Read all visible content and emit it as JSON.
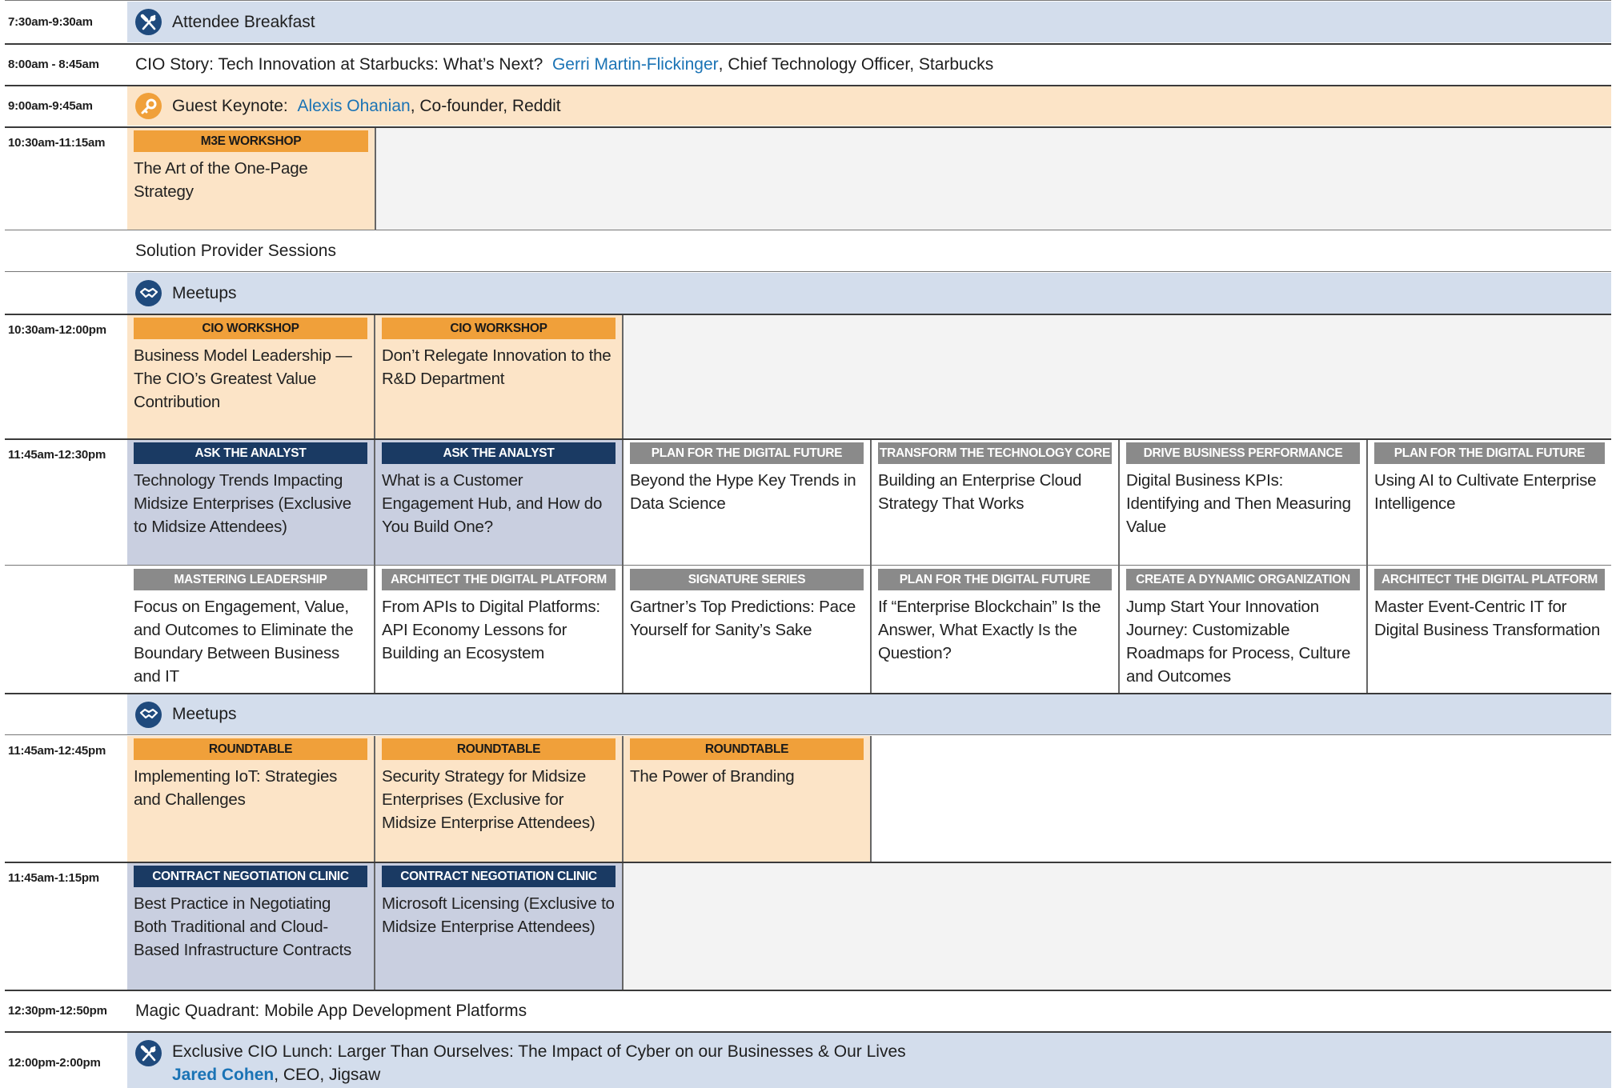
{
  "rows": {
    "breakfast": {
      "time": "7:30am-9:30am",
      "title": "Attendee Breakfast"
    },
    "cio_story": {
      "time": "8:00am - 8:45am",
      "title": "CIO Story: Tech Innovation at Starbucks: What’s Next?",
      "speaker": "Gerri Martin-Flickinger",
      "role": ", Chief Technology Officer, Starbucks"
    },
    "keynote": {
      "time": "9:00am-9:45am",
      "prefix": "Guest Keynote:",
      "speaker": "Alexis Ohanian",
      "role": ", Co-founder, Reddit"
    },
    "workshop_m3e": {
      "time": "10:30am-11:15am",
      "label": "M3E WORKSHOP",
      "title": "The Art of the One-Page Strategy"
    },
    "solution_provider": {
      "title": "Solution Provider Sessions"
    },
    "meetups_1": {
      "title": "Meetups"
    },
    "cio_workshops": {
      "time": "10:30am-12:00pm",
      "items": [
        {
          "label": "CIO WORKSHOP",
          "title": "Business Model Leadership — The CIO’s Greatest Value Contribution"
        },
        {
          "label": "CIO WORKSHOP",
          "title": "Don’t Relegate Innovation to the R&D Department"
        }
      ]
    },
    "sessions_1145": {
      "time": "11:45am-12:30pm",
      "row1": [
        {
          "label": "ASK THE ANALYST",
          "title": "Technology Trends Impacting Midsize Enterprises (Exclusive to Midsize Attendees)"
        },
        {
          "label": "ASK THE ANALYST",
          "title": "What is a Customer Engagement Hub, and How do You Build One?"
        },
        {
          "label": "PLAN FOR THE DIGITAL FUTURE",
          "title": "Beyond the Hype Key Trends in Data Science"
        },
        {
          "label": "TRANSFORM THE TECHNOLOGY CORE",
          "title": "Building an Enterprise Cloud Strategy That Works"
        },
        {
          "label": "DRIVE BUSINESS PERFORMANCE",
          "title": "Digital Business KPIs: Identifying and Then Measuring Value"
        },
        {
          "label": "PLAN FOR THE DIGITAL FUTURE",
          "title": "Using AI to Cultivate Enterprise Intelligence"
        }
      ],
      "row2": [
        {
          "label": "MASTERING LEADERSHIP",
          "title": "Focus on Engagement, Value, and Outcomes to Eliminate the Boundary Between Business and IT"
        },
        {
          "label": "ARCHITECT THE DIGITAL PLATFORM",
          "title": "From APIs to Digital Platforms: API Economy Lessons for Building an Ecosystem"
        },
        {
          "label": "SIGNATURE SERIES",
          "title": "Gartner’s Top Predictions: Pace Yourself for Sanity’s Sake"
        },
        {
          "label": "PLAN FOR THE DIGITAL FUTURE",
          "title": "If “Enterprise Blockchain” Is the Answer, What Exactly Is the Question?"
        },
        {
          "label": "CREATE A DYNAMIC ORGANIZATION",
          "title": "Jump Start Your Innovation Journey: Customizable Roadmaps for Process, Culture and Outcomes"
        },
        {
          "label": "ARCHITECT THE DIGITAL PLATFORM",
          "title": "Master Event-Centric IT for Digital Business Transformation"
        }
      ]
    },
    "meetups_2": {
      "title": "Meetups"
    },
    "roundtables": {
      "time": "11:45am-12:45pm",
      "items": [
        {
          "label": "ROUNDTABLE",
          "title": "Implementing IoT: Strategies and Challenges"
        },
        {
          "label": "ROUNDTABLE",
          "title": "Security Strategy for Midsize Enterprises (Exclusive for Midsize Enterprise Attendees)"
        },
        {
          "label": "ROUNDTABLE",
          "title": "The Power of Branding"
        }
      ]
    },
    "clinics": {
      "time": "11:45am-1:15pm",
      "items": [
        {
          "label": "CONTRACT NEGOTIATION CLINIC",
          "title": "Best Practice in Negotiating Both Traditional and Cloud-Based Infrastructure Contracts"
        },
        {
          "label": "CONTRACT NEGOTIATION CLINIC",
          "title": "Microsoft Licensing (Exclusive to Midsize Enterprise Attendees)"
        }
      ]
    },
    "magic_quadrant": {
      "time": "12:30pm-12:50pm",
      "title": "Magic Quadrant: Mobile App Development Platforms"
    },
    "lunch": {
      "time": "12:00pm-2:00pm",
      "title": "Exclusive CIO Lunch: Larger Than Ourselves: The Impact of Cyber on our Businesses & Our Lives",
      "speaker": "Jared Cohen",
      "role": ", CEO, Jigsaw"
    }
  },
  "icons": {
    "breakfast": "fork-knife-icon",
    "keynote": "key-icon",
    "meetups": "handshake-icon",
    "lunch": "fork-knife-icon"
  },
  "colors": {
    "peach": "#fce4c7",
    "orange_label": "#f0a03a",
    "navy_label": "#1a3a63",
    "gray_label": "#8a8a8a",
    "blue_band": "#d3ddec",
    "lavender": "#c9cfe0",
    "link": "#1a73b5"
  }
}
